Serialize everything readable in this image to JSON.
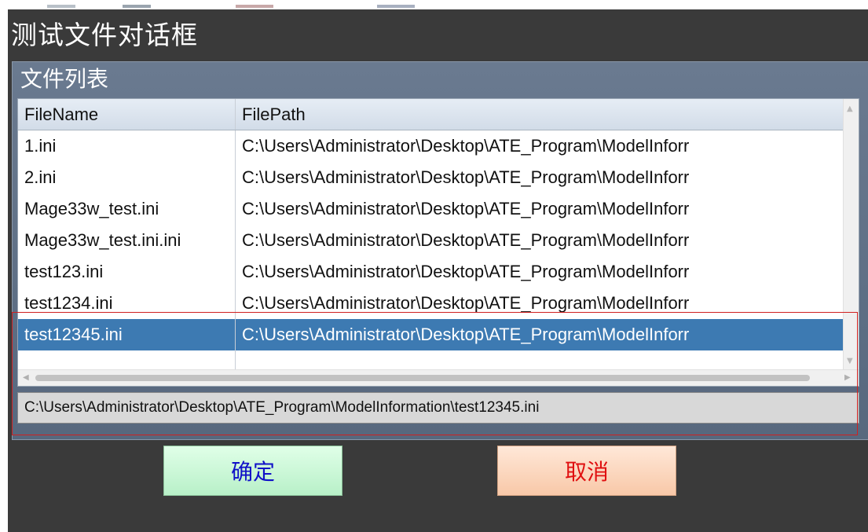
{
  "dialog": {
    "title": "测试文件对话框",
    "group_title": "文件列表"
  },
  "grid": {
    "columns": [
      "FileName",
      "FilePath"
    ],
    "rows": [
      {
        "name": "1.ini",
        "path": "C:\\Users\\Administrator\\Desktop\\ATE_Program\\ModelInforr"
      },
      {
        "name": "2.ini",
        "path": "C:\\Users\\Administrator\\Desktop\\ATE_Program\\ModelInforr"
      },
      {
        "name": "Mage33w_test.ini",
        "path": "C:\\Users\\Administrator\\Desktop\\ATE_Program\\ModelInforr"
      },
      {
        "name": "Mage33w_test.ini.ini",
        "path": "C:\\Users\\Administrator\\Desktop\\ATE_Program\\ModelInforr"
      },
      {
        "name": "test123.ini",
        "path": "C:\\Users\\Administrator\\Desktop\\ATE_Program\\ModelInforr"
      },
      {
        "name": "test1234.ini",
        "path": "C:\\Users\\Administrator\\Desktop\\ATE_Program\\ModelInforr"
      },
      {
        "name": "test12345.ini",
        "path": "C:\\Users\\Administrator\\Desktop\\ATE_Program\\ModelInforr",
        "selected": true
      },
      {
        "name": "",
        "path": ""
      }
    ]
  },
  "selected_path": "C:\\Users\\Administrator\\Desktop\\ATE_Program\\ModelInformation\\test12345.ini",
  "buttons": {
    "ok_label": "确定",
    "cancel_label": "取消"
  },
  "colors": {
    "selection": "#3d7ab2",
    "ok_text": "#1010c8",
    "cancel_text": "#e01010",
    "highlight_box": "#d02020"
  }
}
